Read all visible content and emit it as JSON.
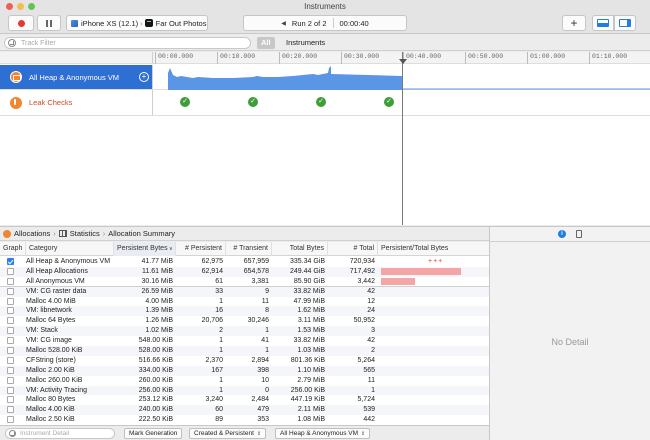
{
  "window": {
    "title": "Instruments"
  },
  "toolbar": {
    "device": "iPhone XS (12.1)",
    "app": "Far Out Photos",
    "run_label": "Run 2 of 2",
    "elapsed": "00:00:40"
  },
  "filter": {
    "placeholder": "Track Filter",
    "scope_all": "All",
    "scope_instruments": "Instruments"
  },
  "ruler": {
    "ticks": [
      "00:00.000",
      "00:10.000",
      "00:20.000",
      "00:30.000",
      "00:40.000",
      "00:50.000",
      "01:00.000",
      "01:10.000"
    ]
  },
  "tracks": [
    {
      "name": "All Heap & Anonymous VM",
      "icon": "allocations-icon"
    },
    {
      "name": "Leak Checks",
      "icon": "leaks-icon"
    }
  ],
  "leak_checks": {
    "count": 4,
    "status": "no leaks"
  },
  "navbar": {
    "instrument": "Allocations",
    "view": "Statistics",
    "detail": "Allocation Summary"
  },
  "table": {
    "columns": [
      "Graph",
      "Category",
      "Persistent Bytes",
      "# Persistent",
      "# Transient",
      "Total Bytes",
      "# Total",
      "Persistent/Total Bytes"
    ],
    "sort_column": "Persistent Bytes",
    "rows": [
      {
        "checked": true,
        "category": "All Heap & Anonymous VM",
        "persistent_bytes": "41.77 MiB",
        "n_persistent": "62,975",
        "n_transient": "657,959",
        "total_bytes": "335.34 GiB",
        "n_total": "720,934",
        "bar": "+++",
        "ratio": 0
      },
      {
        "checked": false,
        "category": "All Heap Allocations",
        "persistent_bytes": "11.61 MiB",
        "n_persistent": "62,914",
        "n_transient": "654,578",
        "total_bytes": "249.44 GiB",
        "n_total": "717,492",
        "ratio": 0.82
      },
      {
        "checked": false,
        "category": "All Anonymous VM",
        "persistent_bytes": "30.16 MiB",
        "n_persistent": "61",
        "n_transient": "3,381",
        "total_bytes": "85.90 GiB",
        "n_total": "3,442",
        "ratio": 0.35
      },
      {
        "checked": false,
        "category": "VM: CG raster data",
        "persistent_bytes": "26.59 MiB",
        "n_persistent": "33",
        "n_transient": "9",
        "total_bytes": "33.82 MiB",
        "n_total": "42",
        "ratio": 0
      },
      {
        "checked": false,
        "category": "Malloc 4.00 MiB",
        "persistent_bytes": "4.00 MiB",
        "n_persistent": "1",
        "n_transient": "11",
        "total_bytes": "47.99 MiB",
        "n_total": "12",
        "ratio": 0
      },
      {
        "checked": false,
        "category": "VM: libnetwork",
        "persistent_bytes": "1.39 MiB",
        "n_persistent": "16",
        "n_transient": "8",
        "total_bytes": "1.62 MiB",
        "n_total": "24",
        "ratio": 0
      },
      {
        "checked": false,
        "category": "Malloc 64 Bytes",
        "persistent_bytes": "1.26 MiB",
        "n_persistent": "20,706",
        "n_transient": "30,246",
        "total_bytes": "3.11 MiB",
        "n_total": "50,952",
        "ratio": 0
      },
      {
        "checked": false,
        "category": "VM: Stack",
        "persistent_bytes": "1.02 MiB",
        "n_persistent": "2",
        "n_transient": "1",
        "total_bytes": "1.53 MiB",
        "n_total": "3",
        "ratio": 0
      },
      {
        "checked": false,
        "category": "VM: CG image",
        "persistent_bytes": "548.00 KiB",
        "n_persistent": "1",
        "n_transient": "41",
        "total_bytes": "33.82 MiB",
        "n_total": "42",
        "ratio": 0
      },
      {
        "checked": false,
        "category": "Malloc 528.00 KiB",
        "persistent_bytes": "528.00 KiB",
        "n_persistent": "1",
        "n_transient": "1",
        "total_bytes": "1.03 MiB",
        "n_total": "2",
        "ratio": 0
      },
      {
        "checked": false,
        "category": "CFString (store)",
        "persistent_bytes": "516.66 KiB",
        "n_persistent": "2,370",
        "n_transient": "2,894",
        "total_bytes": "801.36 KiB",
        "n_total": "5,264",
        "ratio": 0
      },
      {
        "checked": false,
        "category": "Malloc 2.00 KiB",
        "persistent_bytes": "334.00 KiB",
        "n_persistent": "167",
        "n_transient": "398",
        "total_bytes": "1.10 MiB",
        "n_total": "565",
        "ratio": 0
      },
      {
        "checked": false,
        "category": "Malloc 260.00 KiB",
        "persistent_bytes": "260.00 KiB",
        "n_persistent": "1",
        "n_transient": "10",
        "total_bytes": "2.79 MiB",
        "n_total": "11",
        "ratio": 0
      },
      {
        "checked": false,
        "category": "VM: Activity Tracing",
        "persistent_bytes": "256.00 KiB",
        "n_persistent": "1",
        "n_transient": "0",
        "total_bytes": "256.00 KiB",
        "n_total": "1",
        "ratio": 0
      },
      {
        "checked": false,
        "category": "Malloc 80 Bytes",
        "persistent_bytes": "253.12 KiB",
        "n_persistent": "3,240",
        "n_transient": "2,484",
        "total_bytes": "447.19 KiB",
        "n_total": "5,724",
        "ratio": 0
      },
      {
        "checked": false,
        "category": "Malloc 4.00 KiB",
        "persistent_bytes": "240.00 KiB",
        "n_persistent": "60",
        "n_transient": "479",
        "total_bytes": "2.11 MiB",
        "n_total": "539",
        "ratio": 0
      },
      {
        "checked": false,
        "category": "Malloc 2.50 KiB",
        "persistent_bytes": "222.50 KiB",
        "n_persistent": "89",
        "n_transient": "353",
        "total_bytes": "1.08 MiB",
        "n_total": "442",
        "ratio": 0
      }
    ]
  },
  "inspector": {
    "empty_text": "No Detail"
  },
  "bottombar": {
    "detail_placeholder": "Instrument Detail",
    "mark_generation": "Mark Generation",
    "lifespan": "Created & Persistent",
    "category": "All Heap & Anonymous VM"
  },
  "colors": {
    "accent": "#2e6fd4",
    "graph_fill": "#5b95e6",
    "leak_ok": "#3f9d3a",
    "ratio_bar": "#f4a6a6",
    "record": "#e23b2e"
  }
}
